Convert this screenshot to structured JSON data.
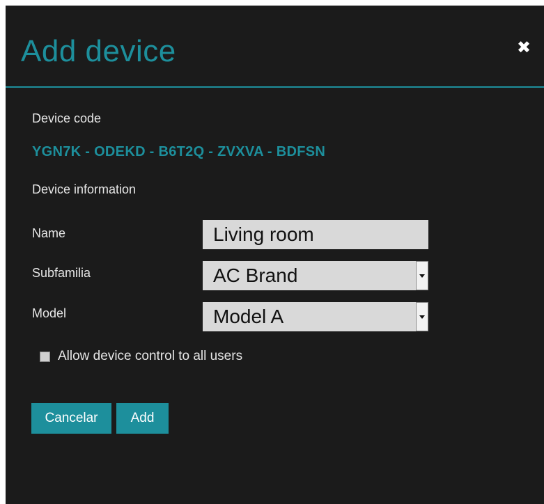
{
  "dialog": {
    "title": "Add device",
    "close_icon": "close-icon"
  },
  "device_code": {
    "label": "Device code",
    "value": "YGN7K - ODEKD - B6T2Q - ZVXVA - BDFSN"
  },
  "device_information": {
    "label": "Device information",
    "name": {
      "label": "Name",
      "value": "Living room"
    },
    "subfamilia": {
      "label": "Subfamilia",
      "value": "AC Brand"
    },
    "model": {
      "label": "Model",
      "value": "Model A"
    }
  },
  "allow_control": {
    "label": "Allow device control to all users",
    "checked": false
  },
  "buttons": {
    "cancel_label": "Cancelar",
    "add_label": "Add"
  },
  "colors": {
    "accent": "#1d8f9c",
    "background": "#1b1b1b",
    "field_background": "#d9d9d9"
  }
}
